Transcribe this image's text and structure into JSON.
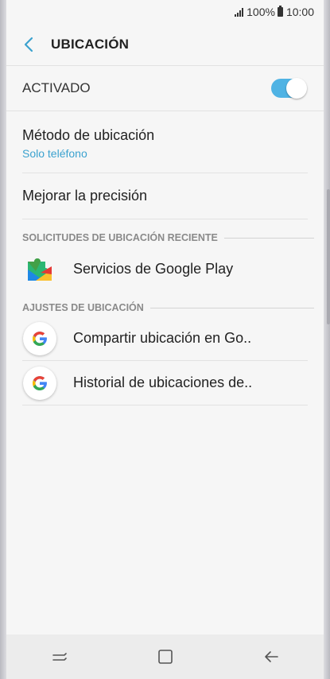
{
  "status_bar": {
    "battery": "100%",
    "time": "10:00",
    "icons": [
      "signal-icon",
      "battery-icon"
    ]
  },
  "header": {
    "title": "UBICACIÓN",
    "back_icon": "back-arrow-icon"
  },
  "master_switch": {
    "label": "ACTIVADO",
    "checked": true,
    "color": "#4fb3e4"
  },
  "settings": {
    "location_method": {
      "title": "Método de ubicación",
      "subtitle": "Solo teléfono"
    },
    "improve_accuracy": {
      "title": "Mejorar la precisión"
    }
  },
  "recent_requests": {
    "header": "SOLICITUDES DE UBICACIÓN RECIENTE",
    "items": [
      {
        "label": "Servicios de Google Play",
        "icon": "google-play-services-icon"
      }
    ]
  },
  "location_settings": {
    "header": "AJUSTES DE UBICACIÓN",
    "items": [
      {
        "label": "Compartir ubicación en Go..",
        "icon": "google-icon"
      },
      {
        "label": "Historial de ubicaciones de..",
        "icon": "google-icon"
      }
    ]
  },
  "nav_bar": {
    "buttons": [
      "recent-apps-icon",
      "home-icon",
      "back-icon"
    ]
  },
  "colors": {
    "accent": "#3ba2cf",
    "background": "#f6f6f6"
  }
}
